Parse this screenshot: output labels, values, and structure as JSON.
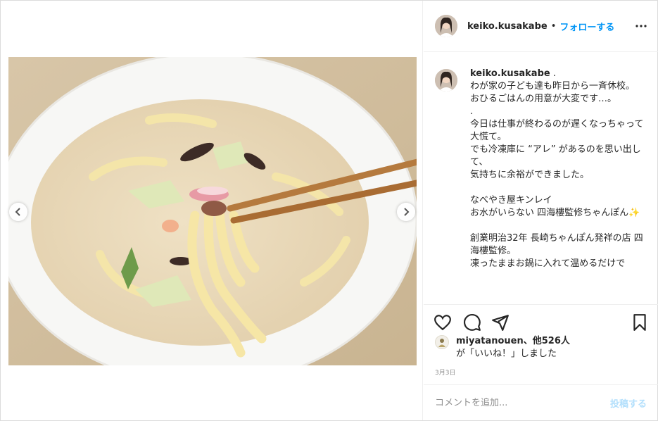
{
  "post": {
    "author": {
      "username": "keiko.kusakabe",
      "separator": "•",
      "follow_label": "フォローする"
    },
    "more_icon": "more-horizontal-icon",
    "caption": {
      "username": "keiko.kusakabe",
      "lines": [
        ".",
        "わが家の子ども達も昨日から一斉休校。",
        "おひるごはんの用意が大変です…。",
        ".",
        "今日は仕事が終わるのが遅くなっちゃって大慌て。",
        "でも冷凍庫に “アレ” があるのを思い出して、",
        "気持ちに余裕ができました。",
        "",
        "なべやき屋キンレイ",
        "お水がいらない 四海樓監修ちゃんぽん✨",
        "",
        "創業明治32年 長崎ちゃんぽん発祥の店 四海樓監修。",
        "凍ったままお鍋に入れて温めるだけで"
      ]
    },
    "actions": {
      "like_icon": "heart-icon",
      "comment_icon": "comment-icon",
      "share_icon": "paper-plane-icon",
      "save_icon": "bookmark-icon"
    },
    "likes": {
      "liker": "miyatanouen",
      "others": "、他526人",
      "suffix": "が「いいね！」しました"
    },
    "date": "3月3日",
    "comment": {
      "placeholder": "コメントを追加...",
      "post_label": "投稿する"
    },
    "carousel": {
      "prev_icon": "chevron-left-icon",
      "next_icon": "chevron-right-icon"
    },
    "colors": {
      "accent": "#0095f6",
      "post_disabled": "#b2dffc",
      "muted": "#8e8e8e"
    }
  }
}
